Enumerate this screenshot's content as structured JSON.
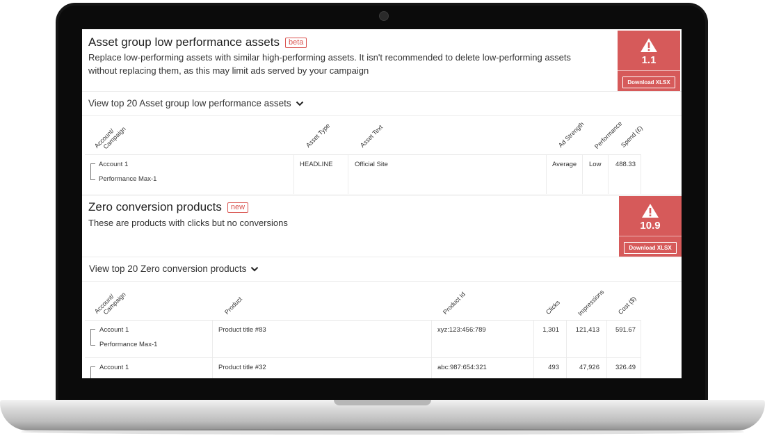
{
  "sections": [
    {
      "title": "Asset group low performance assets",
      "tag": "beta",
      "description_line1": "Replace low-performing assets with similar high-performing assets. It isn't recommended to delete low-performing assets",
      "description_line2": "without replacing them, as this may limit ads served by your campaign",
      "score": "1.1",
      "download_label": "Download XLSX",
      "view_link": "View top 20 Asset group low performance assets",
      "columns": [
        "Account/\nCampaign",
        "Asset Type",
        "Asset Text",
        "Ad Strength",
        "Performance",
        "Spend (£)"
      ],
      "column_labels": {
        "account": "Account/",
        "campaign": "Campaign",
        "asset_type": "Asset Type",
        "asset_text": "Asset Text",
        "ad_strength": "Ad Strength",
        "performance": "Performance",
        "spend": "Spend (£)"
      },
      "rows": [
        {
          "account": "Account 1",
          "campaign": "Performance Max-1",
          "asset_type": "HEADLINE",
          "asset_text": "Official Site",
          "ad_strength": "Average",
          "performance": "Low",
          "spend": "488.33"
        }
      ]
    },
    {
      "title": "Zero conversion products",
      "tag": "new",
      "description_line1": "These are products with clicks but no conversions",
      "score": "10.9",
      "download_label": "Download XLSX",
      "view_link": "View top 20 Zero conversion products",
      "column_labels": {
        "account": "Account/",
        "campaign": "Campaign",
        "product": "Product",
        "product_id": "Product Id",
        "clicks": "Clicks",
        "impressions": "Impressions",
        "cost": "Cost ($)"
      },
      "rows": [
        {
          "account": "Account 1",
          "campaign": "Performance Max-1",
          "product": "Product title #83",
          "product_id": "xyz:123:456:789",
          "clicks": "1,301",
          "impressions": "121,413",
          "cost": "591.67"
        },
        {
          "account": "Account 1",
          "product": "Product title #32",
          "product_id": "abc:987:654:321",
          "clicks": "493",
          "impressions": "47,926",
          "cost": "326.49"
        }
      ]
    }
  ],
  "colors": {
    "alert": "#d65a5a",
    "tag": "#d9534f",
    "bezel": "#161616"
  },
  "icons": [
    "warning-icon",
    "chevron-down-icon"
  ]
}
